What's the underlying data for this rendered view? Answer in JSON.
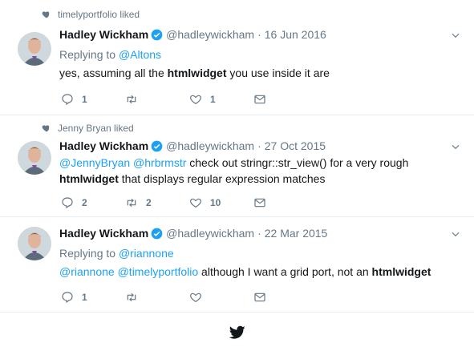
{
  "tweets": [
    {
      "social_context": "timelyportfolio liked",
      "name": "Hadley Wickham",
      "handle": "@hadleywickham",
      "separator": "·",
      "date": "16 Jun 2016",
      "replying_prefix": "Replying to",
      "replying_to": "@Altons",
      "text_pre": "yes, assuming all the ",
      "text_bold": "htmlwidget",
      "text_post": " you use inside it are",
      "reply_count": "1",
      "retweet_count": "",
      "like_count": "1"
    },
    {
      "social_context": "Jenny Bryan liked",
      "name": "Hadley Wickham",
      "handle": "@hadleywickham",
      "separator": "·",
      "date": "27 Oct 2015",
      "mention1": "@JennyBryan",
      "mention2": "@hrbrmstr",
      "line1_text": " check out stringr::str_view() for a very rough",
      "line2_bold": "htmlwidget",
      "line2_text": " that displays regular expression matches",
      "reply_count": "2",
      "retweet_count": "2",
      "like_count": "10"
    },
    {
      "name": "Hadley Wickham",
      "handle": "@hadleywickham",
      "separator": "·",
      "date": "22 Mar 2015",
      "replying_prefix": "Replying to",
      "replying_to": "@riannone",
      "mention1": "@riannone",
      "mention2": "@timelyportfolio",
      "text_pre": " although I want a grid port, not an ",
      "text_bold": "htmlwidget",
      "reply_count": "1",
      "retweet_count": "",
      "like_count": ""
    }
  ],
  "icons": {
    "social": "heart-icon",
    "verified": "verified-badge-icon",
    "menu": "chevron-down-icon",
    "reply": "reply-icon",
    "retweet": "retweet-icon",
    "like": "like-icon",
    "dm": "direct-message-icon",
    "footer": "twitter-bird-icon"
  },
  "colors": {
    "accent": "#1da1f2",
    "muted": "#657786",
    "text": "#14171a",
    "divider": "#e6ecf0"
  }
}
